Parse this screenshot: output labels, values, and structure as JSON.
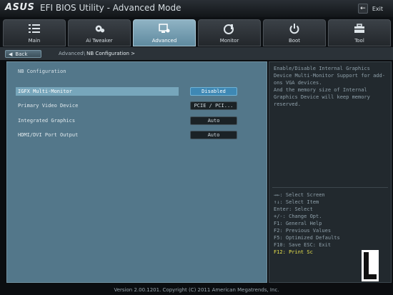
{
  "titlebar": {
    "brand": "ASUS",
    "title": "EFI BIOS Utility - Advanced Mode",
    "exit_label": "Exit"
  },
  "tabs": [
    {
      "label": "Main",
      "icon": "list-icon",
      "active": false
    },
    {
      "label": "Ai Tweaker",
      "icon": "fan-icon",
      "active": false
    },
    {
      "label": "Advanced",
      "icon": "advanced-icon",
      "active": true
    },
    {
      "label": "Monitor",
      "icon": "thermometer-icon",
      "active": false
    },
    {
      "label": "Boot",
      "icon": "power-icon",
      "active": false
    },
    {
      "label": "Tool",
      "icon": "toolbox-icon",
      "active": false
    }
  ],
  "breadcrumb": {
    "back_label": "Back",
    "path": "Advanced\\",
    "current": "NB Configuration >"
  },
  "main": {
    "section_title": "NB Configuration",
    "items": [
      {
        "label": "IGFX Multi-Monitor",
        "value": "Disabled",
        "selected": true
      },
      {
        "label": "Primary Video Device",
        "value": "PCIE / PCI...",
        "selected": false
      },
      {
        "label": "Integrated Graphics",
        "value": "Auto",
        "selected": false
      },
      {
        "label": "HDMI/DVI Port Output",
        "value": "Auto",
        "selected": false
      }
    ]
  },
  "help": {
    "text": "Enable/Disable Internal Graphics Device Multi-Monitor Support for add-ons VGA devices.\nAnd the memory size of Internal Graphics Device will keep memory reserved.",
    "keys": [
      "→←: Select Screen",
      "↑↓: Select Item",
      "Enter: Select",
      "+/-: Change Opt.",
      "F1: General Help",
      "F2: Previous Values",
      "F5: Optimized Defaults",
      "F10: Save  ESC: Exit",
      "F12: Print Sc"
    ],
    "highlight_key_index": 8,
    "highlight_color": "#e8e24c"
  },
  "footer": {
    "version": "Version 2.00.1201. Copyright (C) 2011 American Megatrends, Inc."
  },
  "colors": {
    "accent": "#3e88b4",
    "panel": "#53778a",
    "selected_row": "#77a6bb"
  }
}
